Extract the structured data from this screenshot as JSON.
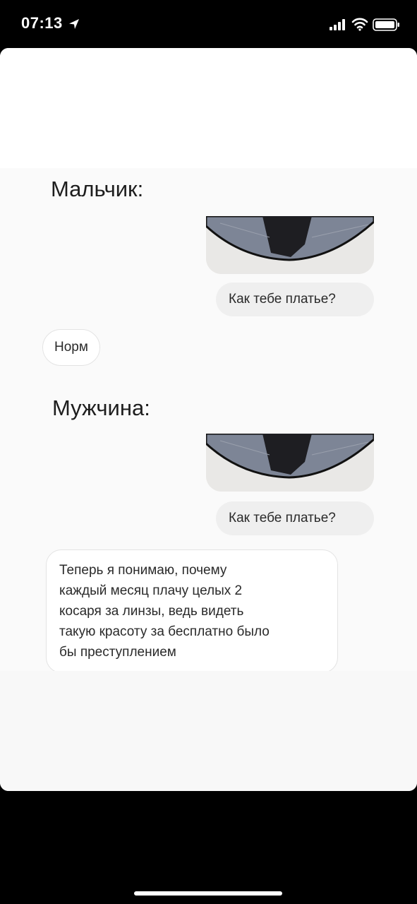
{
  "status_bar": {
    "time": "07:13",
    "icons": [
      "location-arrow-icon",
      "cellular-signal-icon",
      "wifi-icon",
      "battery-icon"
    ]
  },
  "meme": {
    "section_boy": {
      "title": "Мальчик:",
      "outgoing_message": "Как тебе платье?",
      "reply": "Норм"
    },
    "section_man": {
      "title": "Мужчина:",
      "outgoing_message": "Как тебе платье?",
      "reply_lines": [
        "Теперь я понимаю, почему",
        "каждый месяц плачу целых 2",
        "косаря за линзы, ведь видеть",
        "такую красоту за бесплатно было",
        "бы преступлением"
      ]
    }
  },
  "colors": {
    "background": "#000000",
    "sheet": "#ffffff",
    "outgoing_bubble": "#efefef",
    "incoming_bubble_border": "#e3e3e3",
    "text": "#2a2a2a"
  }
}
